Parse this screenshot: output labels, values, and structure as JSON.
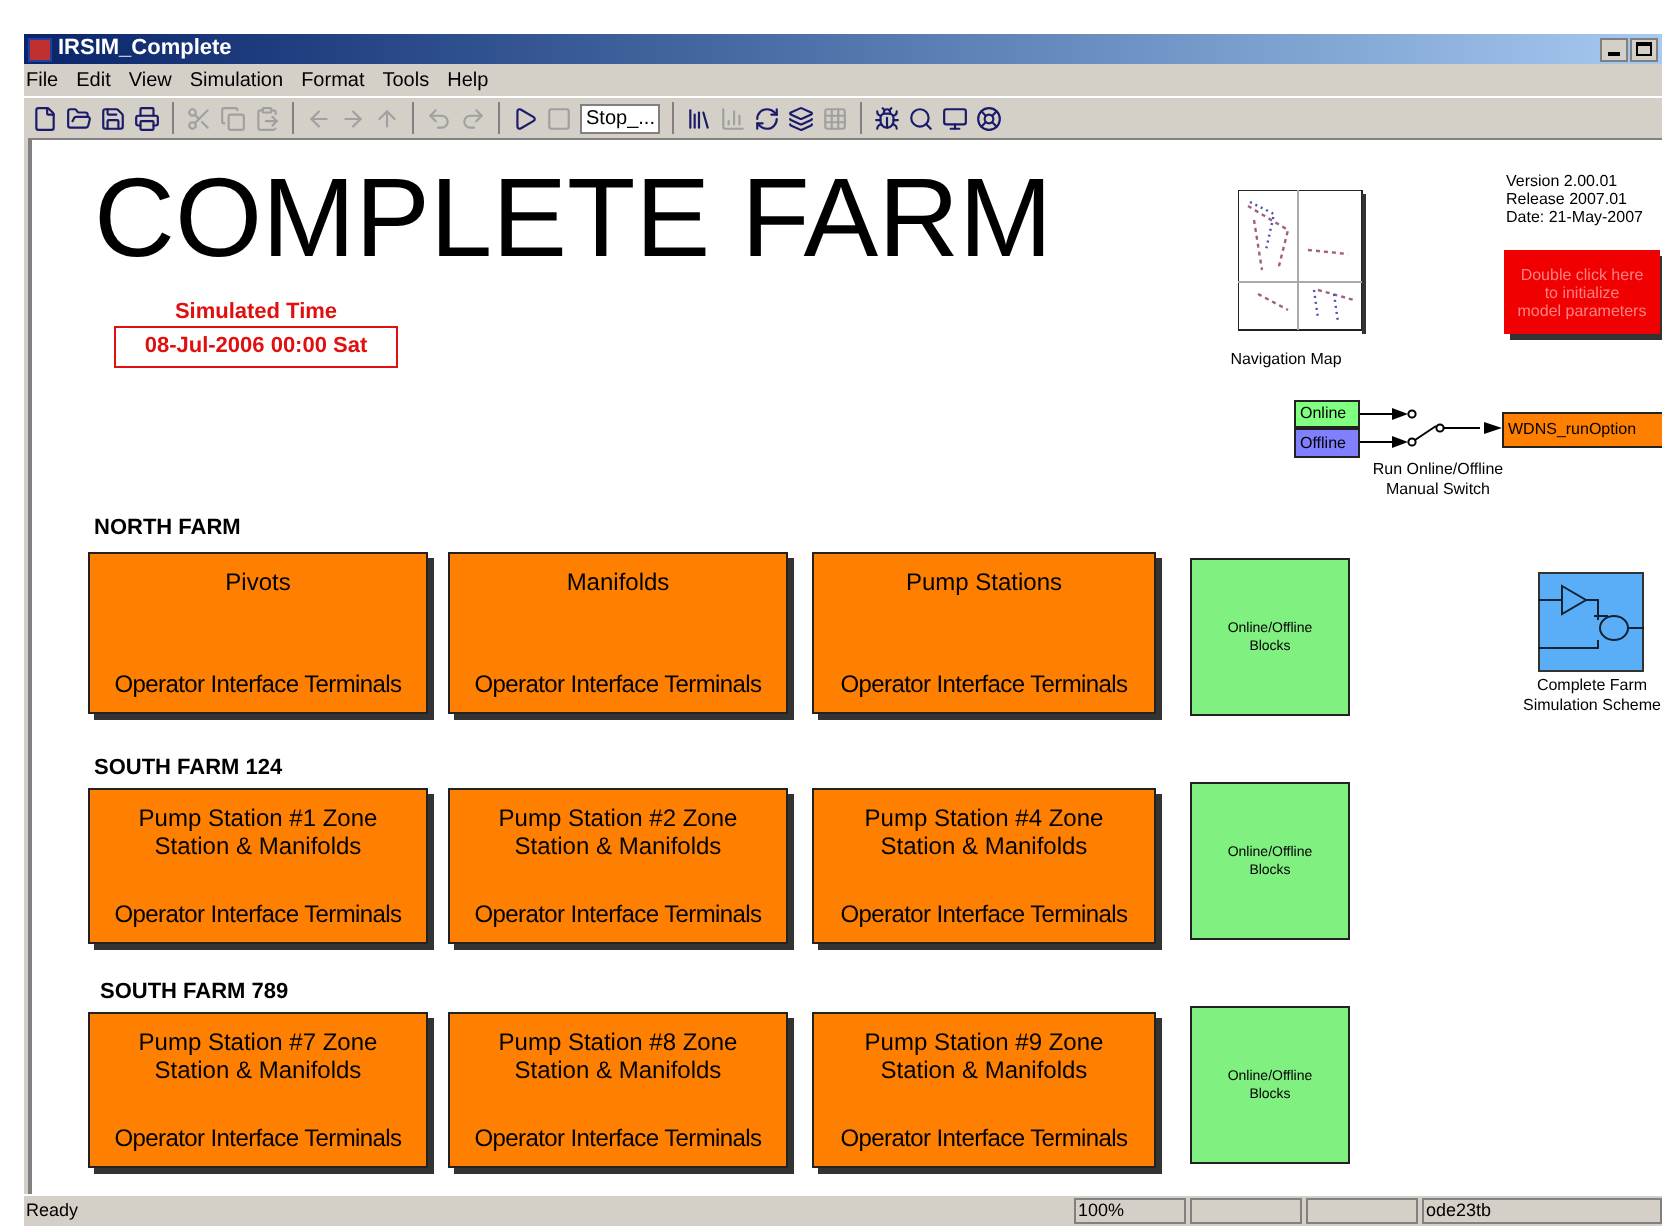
{
  "window": {
    "title": "IRSIM_Complete"
  },
  "menu": [
    "File",
    "Edit",
    "View",
    "Simulation",
    "Format",
    "Tools",
    "Help"
  ],
  "toolbar": {
    "stop_time": "Stop_..."
  },
  "canvas": {
    "title": "COMPLETE FARM",
    "simulated_time": {
      "label": "Simulated Time",
      "value": "08-Jul-2006 00:00 Sat"
    },
    "navigation_map": {
      "label": "Navigation Map"
    },
    "version_info": [
      "Version 2.00.01",
      "Release 2007.01",
      "Date: 21-May-2007"
    ],
    "init_block": {
      "lines": [
        "Double click here",
        "to initialize",
        "model parameters"
      ]
    },
    "switch": {
      "inputs": [
        "Online",
        "Offline"
      ],
      "output": "WDNS_runOption",
      "label_lines": [
        "Run Online/Offline",
        "Manual Switch"
      ]
    },
    "sections": [
      {
        "heading": "NORTH FARM",
        "blocks": [
          {
            "title": "Pivots",
            "subtitle": "Operator Interface Terminals"
          },
          {
            "title": "Manifolds",
            "subtitle": "Operator Interface Terminals"
          },
          {
            "title": "Pump Stations",
            "subtitle": "Operator Interface Terminals"
          }
        ],
        "online_block": "Online/Offline Blocks"
      },
      {
        "heading": "SOUTH FARM 124",
        "blocks": [
          {
            "title": "Pump Station #1 Zone Station & Manifolds",
            "subtitle": "Operator Interface Terminals"
          },
          {
            "title": "Pump Station #2 Zone Station & Manifolds",
            "subtitle": "Operator Interface Terminals"
          },
          {
            "title": "Pump Station #4 Zone Station & Manifolds",
            "subtitle": "Operator Interface Terminals"
          }
        ],
        "online_block": "Online/Offline Blocks"
      },
      {
        "heading": "SOUTH FARM 789",
        "blocks": [
          {
            "title": "Pump Station #7 Zone Station & Manifolds",
            "subtitle": "Operator Interface Terminals"
          },
          {
            "title": "Pump Station #8 Zone Station & Manifolds",
            "subtitle": "Operator Interface Terminals"
          },
          {
            "title": "Pump Station #9 Zone Station & Manifolds",
            "subtitle": "Operator Interface Terminals"
          }
        ],
        "online_block": "Online/Offline Blocks"
      }
    ],
    "scheme_block": {
      "label_lines": [
        "Complete Farm",
        "Simulation Scheme"
      ]
    }
  },
  "status_bar": {
    "message": "Ready",
    "zoom": "100%",
    "solver": "ode23tb"
  }
}
